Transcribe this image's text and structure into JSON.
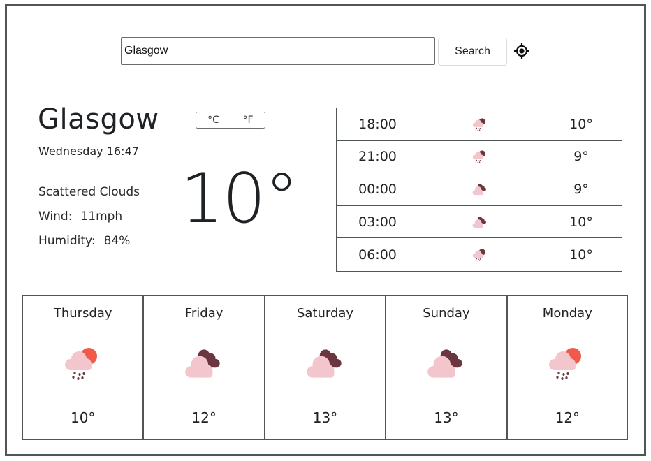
{
  "search": {
    "value": "Glasgow",
    "button_label": "Search",
    "locate_icon": "crosshair-location-icon"
  },
  "current": {
    "city": "Glasgow",
    "datetime": "Wednesday 16:47",
    "description": "Scattered Clouds",
    "wind_label": "Wind:",
    "wind_value": "11mph",
    "humidity_label": "Humidity:",
    "humidity_value": "84%",
    "temperature": "10°",
    "units": {
      "celsius": "°C",
      "fahrenheit": "°F"
    }
  },
  "hourly": [
    {
      "time": "18:00",
      "icon": "night-rain-icon",
      "temp": "10°"
    },
    {
      "time": "21:00",
      "icon": "night-rain-icon",
      "temp": "9°"
    },
    {
      "time": "00:00",
      "icon": "broken-clouds-icon",
      "temp": "9°"
    },
    {
      "time": "03:00",
      "icon": "broken-clouds-icon",
      "temp": "10°"
    },
    {
      "time": "06:00",
      "icon": "night-rain-icon",
      "temp": "10°"
    }
  ],
  "daily": [
    {
      "day": "Thursday",
      "icon": "day-rain-icon",
      "temp": "10°"
    },
    {
      "day": "Friday",
      "icon": "broken-clouds-icon",
      "temp": "12°"
    },
    {
      "day": "Saturday",
      "icon": "broken-clouds-icon",
      "temp": "13°"
    },
    {
      "day": "Sunday",
      "icon": "broken-clouds-icon",
      "temp": "13°"
    },
    {
      "day": "Monday",
      "icon": "day-rain-icon",
      "temp": "12°"
    }
  ],
  "colors": {
    "cloud_light": "#f2c6cc",
    "cloud_dark": "#6b3640",
    "sun": "#f15a4a",
    "rain": "#6b3640",
    "border": "#4f5653"
  }
}
